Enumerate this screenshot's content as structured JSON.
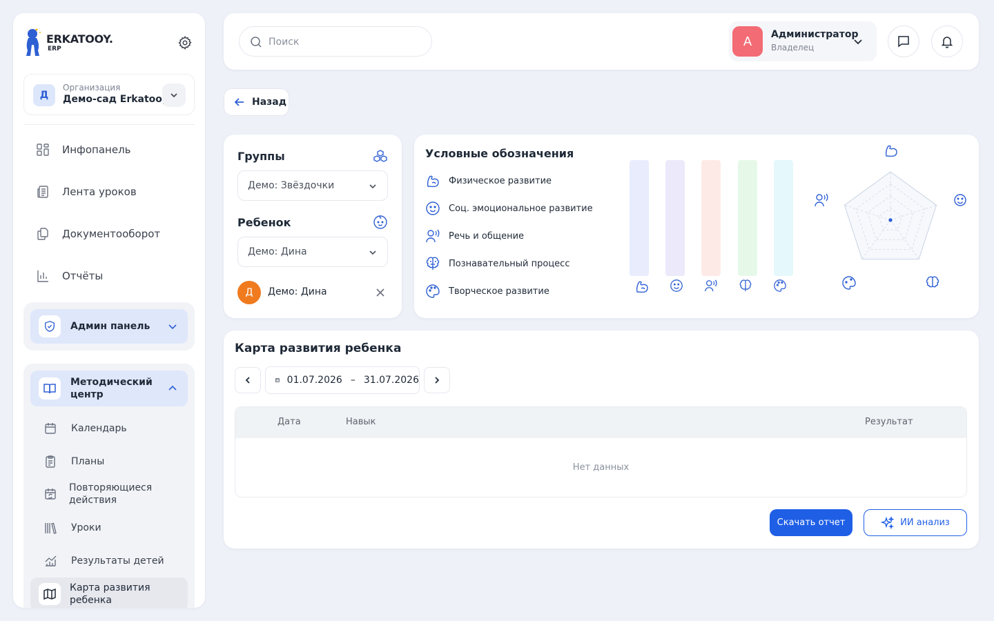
{
  "brand": {
    "name": "ERKATOOY.",
    "sub": "ERP"
  },
  "org": {
    "avatar": "Д",
    "label": "Организация",
    "name": "Демо-сад Erkatooy"
  },
  "nav": [
    {
      "label": "Инфопанель",
      "icon": "grid-icon"
    },
    {
      "label": "Лента уроков",
      "icon": "newspaper-icon"
    },
    {
      "label": "Документооборот",
      "icon": "documents-icon"
    },
    {
      "label": "Отчёты",
      "icon": "bar-chart-icon"
    }
  ],
  "admin_group": {
    "label": "Админ панель",
    "icon": "shield-icon"
  },
  "method_group": {
    "label_line1": "Методический",
    "label_line2": "центр",
    "items": [
      {
        "label": "Календарь",
        "icon": "calendar-icon"
      },
      {
        "label": "Планы",
        "icon": "clipboard-icon"
      },
      {
        "label_line1": "Повторяющиеся",
        "label_line2": "действия",
        "icon": "calendar-repeat-icon"
      },
      {
        "label": "Уроки",
        "icon": "books-icon"
      },
      {
        "label": "Результаты детей",
        "icon": "chart-up-icon"
      }
    ],
    "active": {
      "label_line1": "Карта развития",
      "label_line2": "ребенка",
      "icon": "map-icon"
    }
  },
  "search": {
    "placeholder": "Поиск"
  },
  "user": {
    "avatar": "А",
    "name": "Администратор",
    "role": "Владелец"
  },
  "back": {
    "label": "Назад"
  },
  "filters": {
    "groups_title": "Группы",
    "group_value": "Демо: Звёздочки",
    "child_title": "Ребенок",
    "child_value": "Демо: Дина",
    "selected_child": {
      "avatar": "Д",
      "name": "Демо: Дина"
    }
  },
  "legend": {
    "title": "Условные обозначения",
    "items": [
      {
        "label": "Физическое развитие",
        "icon": "muscle-icon",
        "color": "#e8ecfd"
      },
      {
        "label": "Соц. эмоциональное развитие",
        "icon": "smile-icon",
        "color": "#ece9fb"
      },
      {
        "label": "Речь и общение",
        "icon": "speech-icon",
        "color": "#fdeae6"
      },
      {
        "label": "Познавательный процесс",
        "icon": "brain-icon",
        "color": "#e6f9e8"
      },
      {
        "label": "Творческое развитие",
        "icon": "palette-icon",
        "color": "#e5f8fc"
      }
    ]
  },
  "radar": {
    "values": [
      0,
      0,
      0,
      0,
      0
    ],
    "max": 4
  },
  "map": {
    "title": "Карта развития ребенка",
    "date_from": "01.07.2026",
    "date_sep": "–",
    "date_to": "31.07.2026",
    "columns": [
      "Дата",
      "Навык",
      "Результат"
    ],
    "rows": [],
    "empty": "Нет данных",
    "download_label": "Скачать отчет",
    "ai_label": "ИИ анализ"
  },
  "colors": {
    "accent": "#1f5fe6",
    "nav_active": "#dfe7fb"
  }
}
